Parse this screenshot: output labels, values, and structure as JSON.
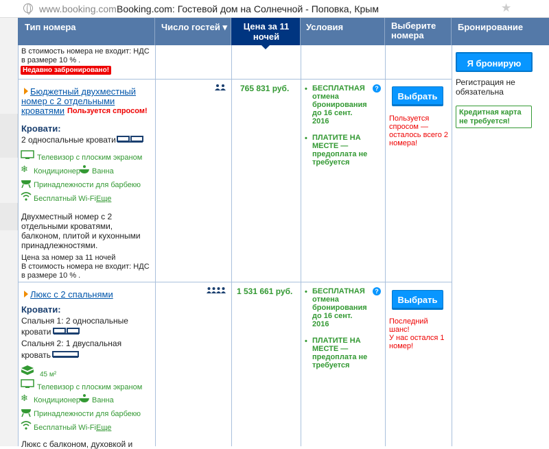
{
  "addressbar": {
    "host": "www.booking.com",
    "title": "Booking.com: Гостевой дом на Солнечной - Поповка, Крым"
  },
  "headers": {
    "room_type": "Тип номера",
    "guests": "Число гостей ▾",
    "price": "Цена за 11 ночей",
    "conditions": "Условия",
    "select": "Выберите номера",
    "booking": "Бронирование"
  },
  "top_partial": {
    "vat_line1": "В стоимость номера не входит: НДС",
    "vat_line2": "в размере 10 % .",
    "badge": "Недавно забронировано!"
  },
  "booking_panel": {
    "book_button": "Я бронирую",
    "reg_line1": "Регистрация не",
    "reg_line2": "обязательна",
    "card_line1": "Кредитная карта",
    "card_line2": "не требуется!"
  },
  "rooms": [
    {
      "name_line1": "Бюджетный двухместный",
      "name_line2": "номер с 2 отдельными",
      "name_line3": "кроватями",
      "demand": "Пользуется спросом!",
      "beds_title": "Кровати:",
      "beds_line1": "2 односпальные кровати",
      "amenity_tv": "Телевизор с плоским экраном",
      "amenity_ac": "Кондиционер",
      "amenity_bath": "Ванна",
      "amenity_bbq": "Принадлежности для барбекю",
      "amenity_wifi": "Бесплатный Wi-Fi",
      "more": "Еще",
      "desc1": "Двухместный номер с 2",
      "desc2": "отдельными кроватями,",
      "desc3": "балконом, плитой и кухонными",
      "desc4": "принадлежностями.",
      "price_for": "Цена за номер за 11 ночей",
      "vat1": "В стоимость номера не входит: НДС",
      "vat2": "в размере 10 % .",
      "price": "765 831 руб.",
      "cancel1": "БЕСПЛАТНАЯ",
      "cancel2": "отмена",
      "cancel3": "бронирования",
      "cancel4": "до 16 сент.",
      "cancel5": "2016",
      "pay1": "ПЛАТИТЕ НА",
      "pay2": "МЕСТЕ —",
      "pay3": "предоплата не",
      "pay4": "требуется",
      "select_button": "Выбрать",
      "note1": "Пользуется",
      "note2": "спросом —",
      "note3": "осталось всего 2",
      "note4": "номера!"
    },
    {
      "name_line1": "Люкс с 2 спальнями",
      "beds_title": "Кровати:",
      "bed1_line1": "Спальня 1: 2 односпальные",
      "bed1_line2": "кровати",
      "bed2_line1": "Спальня 2: 1 двуспальная",
      "bed2_line2": "кровать",
      "area": "45 м²",
      "amenity_tv": "Телевизор с плоским экраном",
      "amenity_ac": "Кондиционер",
      "amenity_bath": "Ванна",
      "amenity_bbq": "Принадлежности для барбекю",
      "amenity_wifi": "Бесплатный Wi-Fi",
      "more": "Еще",
      "desc1": "Люкс с балконом, духовкой и",
      "price": "1 531 661 руб.",
      "cancel1": "БЕСПЛАТНАЯ",
      "cancel2": "отмена",
      "cancel3": "бронирования",
      "cancel4": "до 16 сент.",
      "cancel5": "2016",
      "pay1": "ПЛАТИТЕ НА",
      "pay2": "МЕСТЕ —",
      "pay3": "предоплата не",
      "pay4": "требуется",
      "select_button": "Выбрать",
      "note1": "Последний",
      "note2": "шанс!",
      "note3": "У нас остался 1",
      "note4": "номер!"
    }
  ],
  "colors": {
    "header": "#5479a8",
    "header_selected": "#003580",
    "accent": "#0896ff",
    "green": "#339933",
    "red": "#e00000"
  }
}
